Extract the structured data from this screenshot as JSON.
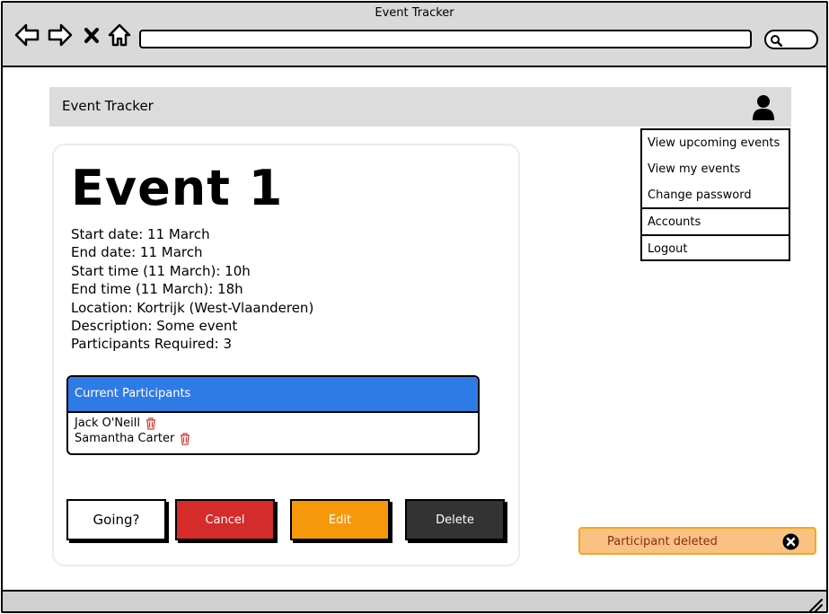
{
  "browser": {
    "window_title": "Event Tracker"
  },
  "app": {
    "title": "Event Tracker"
  },
  "menu": {
    "items": [
      {
        "label": "View upcoming events"
      },
      {
        "label": "View my events"
      },
      {
        "label": "Change password"
      },
      {
        "label": "Accounts"
      },
      {
        "label": "Logout"
      }
    ]
  },
  "event": {
    "title": "Event 1",
    "details": [
      "Start date: 11 March",
      "End date: 11 March",
      "Start time (11 March): 10h",
      "End time (11 March): 18h",
      "Location: Kortrijk (West-Vlaanderen)",
      "Description: Some event",
      "Participants Required: 3"
    ]
  },
  "participants": {
    "header": "Current Participants",
    "list": [
      {
        "name": "Jack O'Neill"
      },
      {
        "name": "Samantha Carter"
      }
    ]
  },
  "actions": {
    "going": "Going?",
    "cancel": "Cancel",
    "edit": "Edit",
    "delete": "Delete"
  },
  "toast": {
    "message": "Participant deleted"
  },
  "colors": {
    "participants_header": "#2f7be6",
    "cancel": "#d52b2b",
    "edit": "#f5990a",
    "delete": "#333333",
    "toast_bg": "#f9c282",
    "toast_text": "#8c2d16",
    "trash": "#d9342b"
  }
}
